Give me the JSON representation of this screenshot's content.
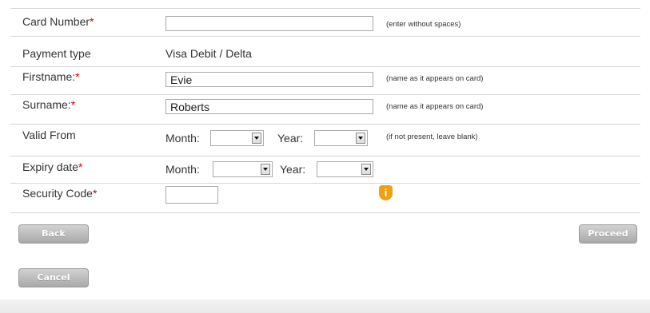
{
  "form": {
    "card_number": {
      "label": "Card Number",
      "required_mark": "*",
      "value": "",
      "hint": "(enter without spaces)"
    },
    "payment_type": {
      "label": "Payment type",
      "value": "Visa Debit / Delta"
    },
    "firstname": {
      "label": "Firstname:",
      "required_mark": "*",
      "value": "Evie",
      "hint": "(name as it appears on card)"
    },
    "surname": {
      "label": "Surname:",
      "required_mark": "*",
      "value": "Roberts",
      "hint": "(name as it appears on card)"
    },
    "valid_from": {
      "label": "Valid From",
      "month_label": "Month:",
      "year_label": "Year:",
      "month_value": "",
      "year_value": "",
      "hint": "(if not present, leave blank)"
    },
    "expiry_date": {
      "label": "Expiry date",
      "required_mark": "*",
      "month_label": "Month:",
      "year_label": "Year:",
      "month_value": "",
      "year_value": ""
    },
    "security_code": {
      "label": "Security Code",
      "required_mark": "*",
      "value": "",
      "info_icon": "info-icon"
    }
  },
  "buttons": {
    "back": "Back",
    "proceed": "Proceed",
    "cancel": "Cancel"
  },
  "colors": {
    "required": "#cc0000",
    "info_icon": "#f0a012",
    "button": "#b8b8b8"
  }
}
